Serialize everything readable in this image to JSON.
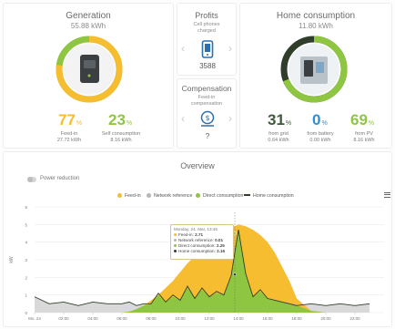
{
  "generation": {
    "title": "Generation",
    "value": "55.88 kWh",
    "feed_in_pct": "77",
    "feed_in_unit": "%",
    "feed_in_label": "Feed-in",
    "feed_in_value": "27.72 kWh",
    "self_pct": "23",
    "self_unit": "%",
    "self_label": "Self consumption",
    "self_value": "8.16 kWh",
    "feed_in_fraction": 0.77
  },
  "profits": {
    "title": "Profits",
    "caption_line1": "Cell phones",
    "caption_line2": "charged",
    "value": "3588",
    "icon": "phone-icon"
  },
  "compensation": {
    "title": "Compensation",
    "caption_line1": "Feed-in",
    "caption_line2": "compensation",
    "value": "?",
    "icon": "money-icon"
  },
  "home": {
    "title": "Home consumption",
    "value": "11.80 kWh",
    "grid_pct": "31",
    "grid_label": "from grid",
    "grid_value": "0.64 kWh",
    "battery_pct": "0",
    "battery_label": "from battery",
    "battery_value": "0.00 kWh",
    "pv_pct": "69",
    "pv_label": "from PV",
    "pv_value": "8.16 kWh",
    "unit": "%",
    "pv_fraction": 0.69
  },
  "overview": {
    "title": "Overview",
    "toggle_label": "Power reduction",
    "menu_icon": "hamburger-icon"
  },
  "colors": {
    "yellow": "#f5bd2f",
    "green": "#8fc641",
    "blue": "#2b8fd6",
    "gray": "#9a9a9a",
    "dark": "#2f3d2a"
  },
  "chart_data": {
    "type": "area",
    "legend": [
      "Feed-in",
      "Network reference",
      "Direct consumption",
      "Home consumption"
    ],
    "x_ticks": [
      "Mo. 24",
      "02:00",
      "04:00",
      "06:00",
      "08:00",
      "10:00",
      "12:00",
      "14:00",
      "16:00",
      "18:00",
      "20:00",
      "22:00"
    ],
    "y_ticks": [
      "0",
      "1",
      "2",
      "3",
      "4",
      "5",
      "6"
    ],
    "ylabel": "kW",
    "ylim": [
      0,
      6
    ],
    "x_hours": [
      0,
      1,
      2,
      3,
      4,
      5,
      6,
      6.5,
      7,
      7.5,
      8,
      8.5,
      9,
      9.5,
      10,
      10.5,
      11,
      11.5,
      12,
      12.5,
      13,
      13.5,
      14,
      14.5,
      15,
      15.5,
      16,
      16.5,
      17,
      17.5,
      18,
      19,
      20,
      21,
      22,
      23
    ],
    "series": [
      {
        "name": "Feed-in",
        "values": [
          0,
          0,
          0,
          0,
          0,
          0,
          0,
          0.05,
          0.2,
          0.4,
          0.7,
          1.0,
          1.4,
          1.8,
          2.3,
          2.8,
          3.2,
          3.6,
          3.9,
          4.2,
          4.5,
          4.8,
          5.0,
          4.9,
          4.7,
          4.4,
          4.0,
          3.4,
          2.6,
          1.8,
          0.8,
          0.1,
          0,
          0,
          0,
          0
        ]
      },
      {
        "name": "Direct consumption",
        "values": [
          0,
          0,
          0,
          0,
          0,
          0,
          0,
          0.05,
          0.2,
          0.4,
          0.5,
          1.0,
          0.6,
          0.9,
          0.7,
          1.4,
          0.8,
          1.3,
          0.9,
          1.1,
          1.0,
          2.0,
          4.7,
          2.1,
          0.9,
          1.2,
          0.8,
          0.7,
          0.6,
          0.5,
          0.4,
          0.1,
          0,
          0,
          0,
          0
        ]
      },
      {
        "name": "Home consumption",
        "values": [
          0.9,
          0.5,
          0.6,
          0.4,
          0.6,
          0.5,
          0.5,
          0.6,
          0.4,
          0.5,
          0.5,
          1.1,
          0.6,
          1.0,
          0.7,
          1.5,
          0.8,
          1.4,
          0.9,
          1.2,
          1.0,
          2.1,
          4.7,
          2.2,
          0.9,
          1.3,
          0.8,
          0.7,
          0.6,
          0.5,
          0.4,
          0.5,
          0.4,
          0.5,
          0.4,
          0.5
        ]
      }
    ],
    "tooltip": {
      "title": "Monday, 24. Mar, 13:45",
      "rows": [
        {
          "label": "Feed-in",
          "value": "2.71"
        },
        {
          "label": "Network reference",
          "value": "0.01"
        },
        {
          "label": "Direct consumption",
          "value": "2.25"
        },
        {
          "label": "Home consumption",
          "value": "2.16"
        }
      ]
    }
  }
}
